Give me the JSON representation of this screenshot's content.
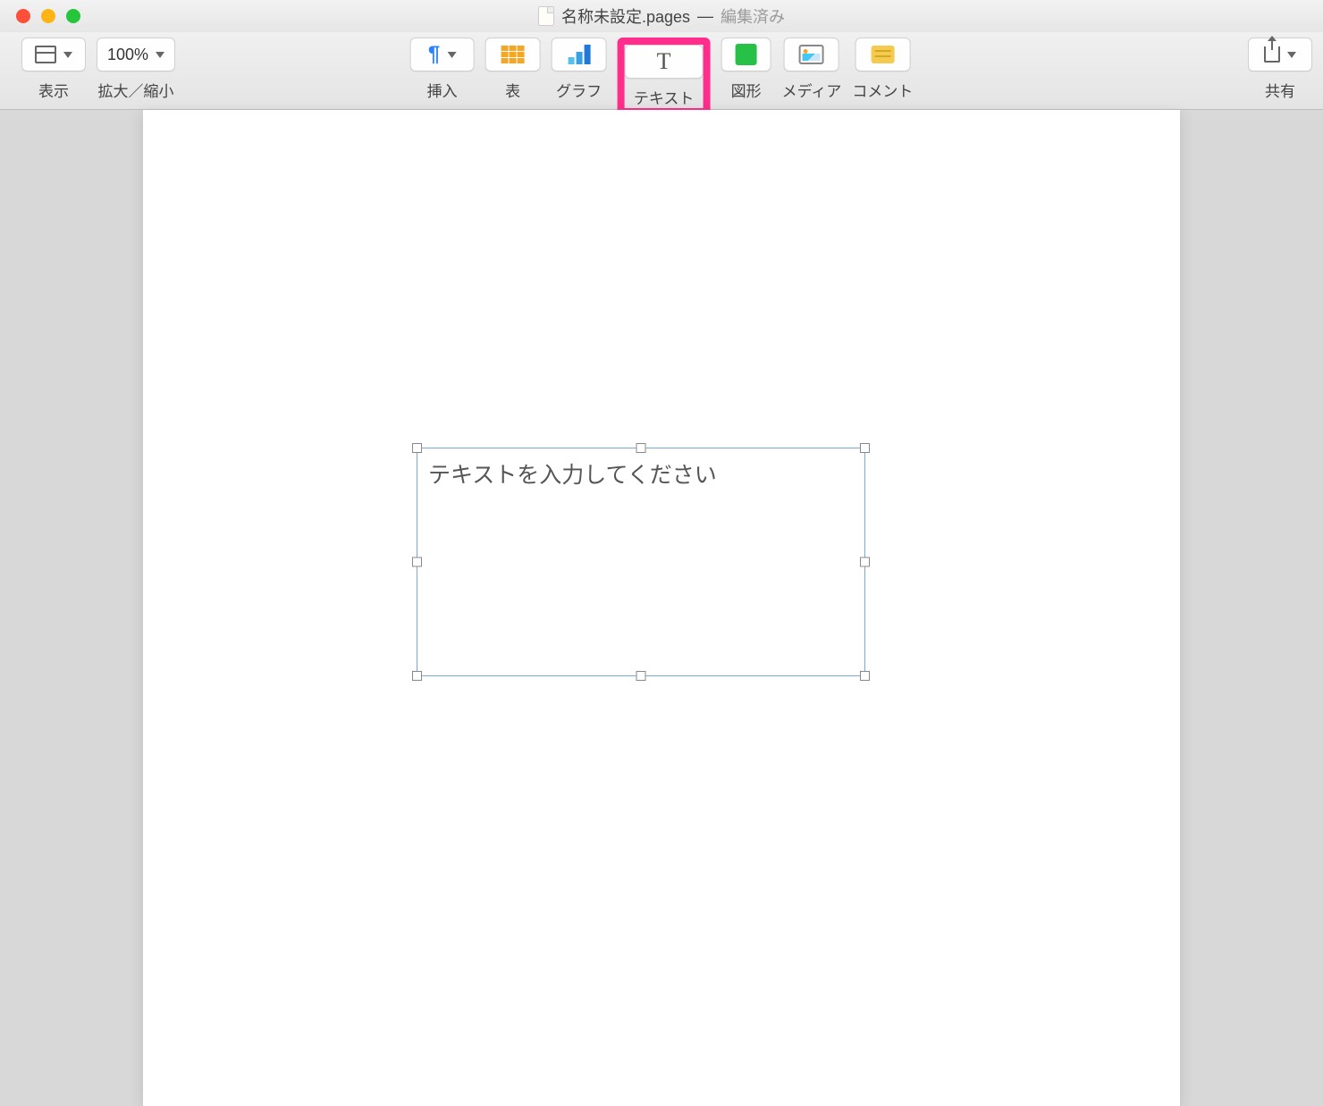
{
  "window": {
    "title": "名称未設定.pages",
    "status": "編集済み"
  },
  "toolbar": {
    "view": {
      "label": "表示"
    },
    "zoom": {
      "label": "拡大／縮小",
      "value": "100%"
    },
    "insert": {
      "label": "挿入"
    },
    "table": {
      "label": "表"
    },
    "chart": {
      "label": "グラフ"
    },
    "text": {
      "label": "テキスト"
    },
    "shape": {
      "label": "図形"
    },
    "media": {
      "label": "メディア"
    },
    "comment": {
      "label": "コメント"
    },
    "share": {
      "label": "共有"
    }
  },
  "document": {
    "textbox_placeholder": "テキストを入力してください"
  }
}
